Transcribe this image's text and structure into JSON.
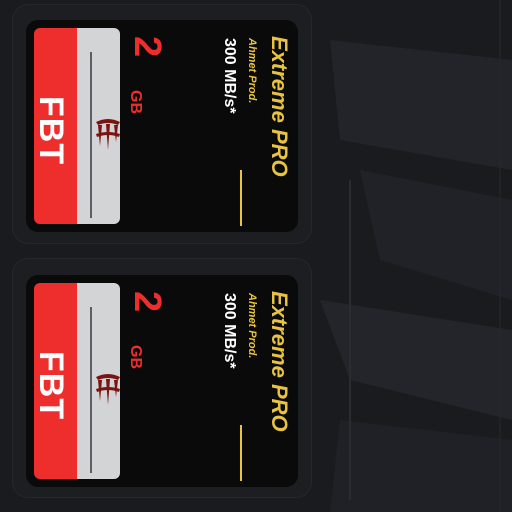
{
  "background_color": "#1a1b1f",
  "colors": {
    "card_body": "#0a0a0b",
    "label_red": "#ee2e2c",
    "label_grey": "#d3d4d6",
    "capacity_red": "#ee2e2c",
    "brand_gold": "#e8c341",
    "speed_white": "#ffffff"
  },
  "cards": [
    {
      "capacity_number": "2",
      "capacity_unit": "GB",
      "speed_text": "300 MB/s*",
      "brand": "Ahmet Prod.",
      "product": "Extreme PRO",
      "label_code": "FBT",
      "mark_icon": "dripping-mark-icon"
    },
    {
      "capacity_number": "2",
      "capacity_unit": "GB",
      "speed_text": "300 MB/s*",
      "brand": "Ahmet Prod.",
      "product": "Extreme PRO",
      "label_code": "FBT",
      "mark_icon": "dripping-mark-icon"
    }
  ]
}
